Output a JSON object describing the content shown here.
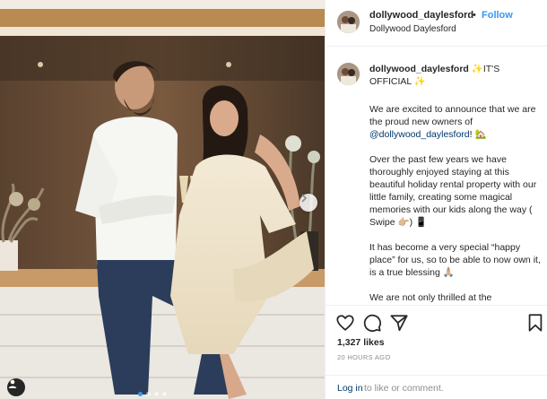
{
  "header": {
    "username": "dollywood_daylesford",
    "separator": "•",
    "follow_label": "Follow",
    "location": "Dollywood Daylesford"
  },
  "caption": {
    "username": "dollywood_daylesford",
    "headline": "✨IT'S OFFICIAL ✨",
    "paragraphs": [
      {
        "before": "We are excited to announce that we are the proud new owners of ",
        "mention": "@dollywood_daylesford",
        "after": "! 🏡"
      },
      {
        "before": "Over the past few years we have thoroughly enjoyed staying at this beautiful holiday rental property with our little family, creating some magical memories with our kids along the way ( Swipe 👉🏼) 📱",
        "mention": "",
        "after": ""
      },
      {
        "before": "It has become a very special “happy place” for us, so to be able to now own it, is a true blessing 🙏🏼",
        "mention": "",
        "after": ""
      },
      {
        "before": "We are not only thrilled at the",
        "mention": "",
        "after": ""
      }
    ]
  },
  "stats": {
    "likes": "1,327 likes",
    "timestamp": "20 HOURS AGO"
  },
  "comment": {
    "login_label": "Log in",
    "rest": "to like or comment."
  },
  "carousel": {
    "slide_count": 4,
    "active_slide": 1
  },
  "colors": {
    "accent": "#3897f0",
    "link": "#00376b",
    "muted": "#8e8e8e",
    "text": "#262626",
    "border": "#efefef"
  },
  "icons": [
    "heart-icon",
    "comment-icon",
    "share-icon",
    "bookmark-icon",
    "chevron-right-icon",
    "user-tag-icon"
  ]
}
